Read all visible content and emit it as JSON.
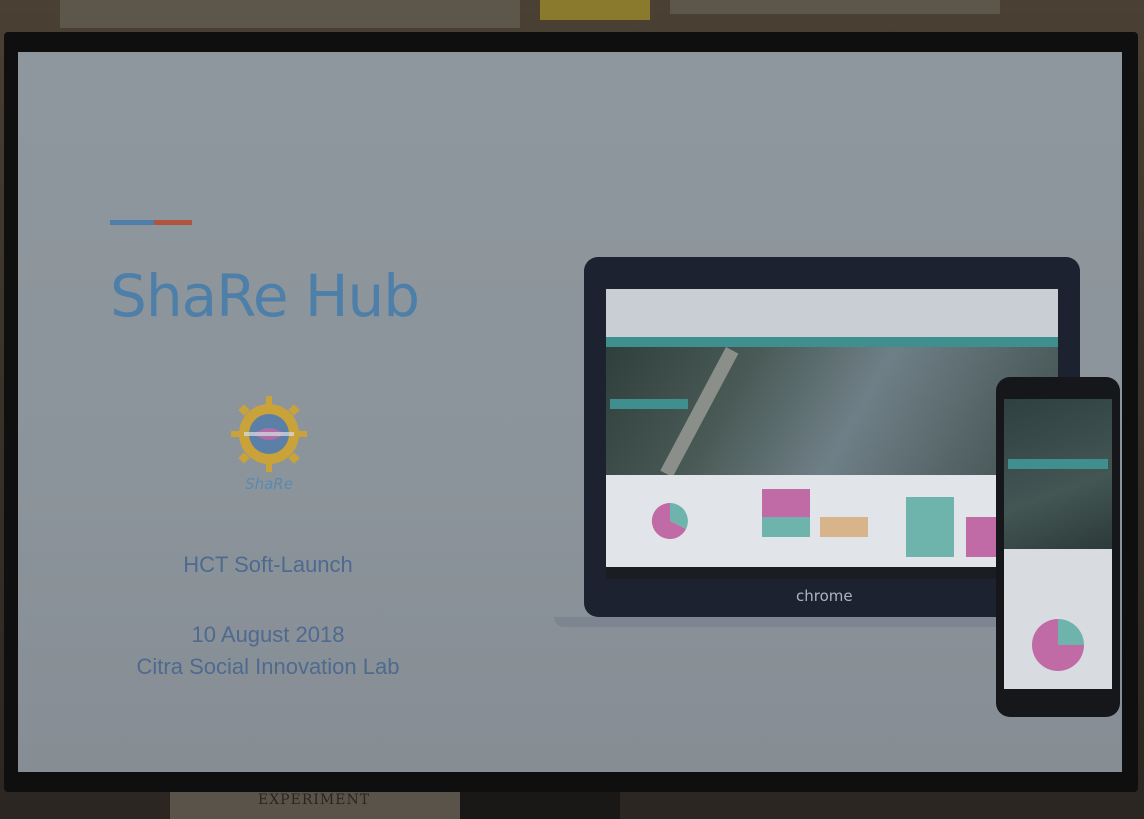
{
  "slide": {
    "title": "ShaRe Hub",
    "logo_text": "ShaRe",
    "event": "HCT Soft-Launch",
    "date": "10 August 2018",
    "venue": "Citra Social Innovation Lab"
  },
  "device_mockup": {
    "laptop_brand": "chrome"
  },
  "background": {
    "bottom_sign": "EXPERIMENT"
  },
  "colors": {
    "title": "#4d7fa8",
    "accent_blue": "#4f7fa8",
    "accent_red": "#b0543e",
    "subtitle": "#4e6a90",
    "logo_gold": "#c9a23a",
    "site_teal": "#3e8f8e",
    "chart_pink": "#c06aa6",
    "chart_teal": "#6fb3ad"
  }
}
